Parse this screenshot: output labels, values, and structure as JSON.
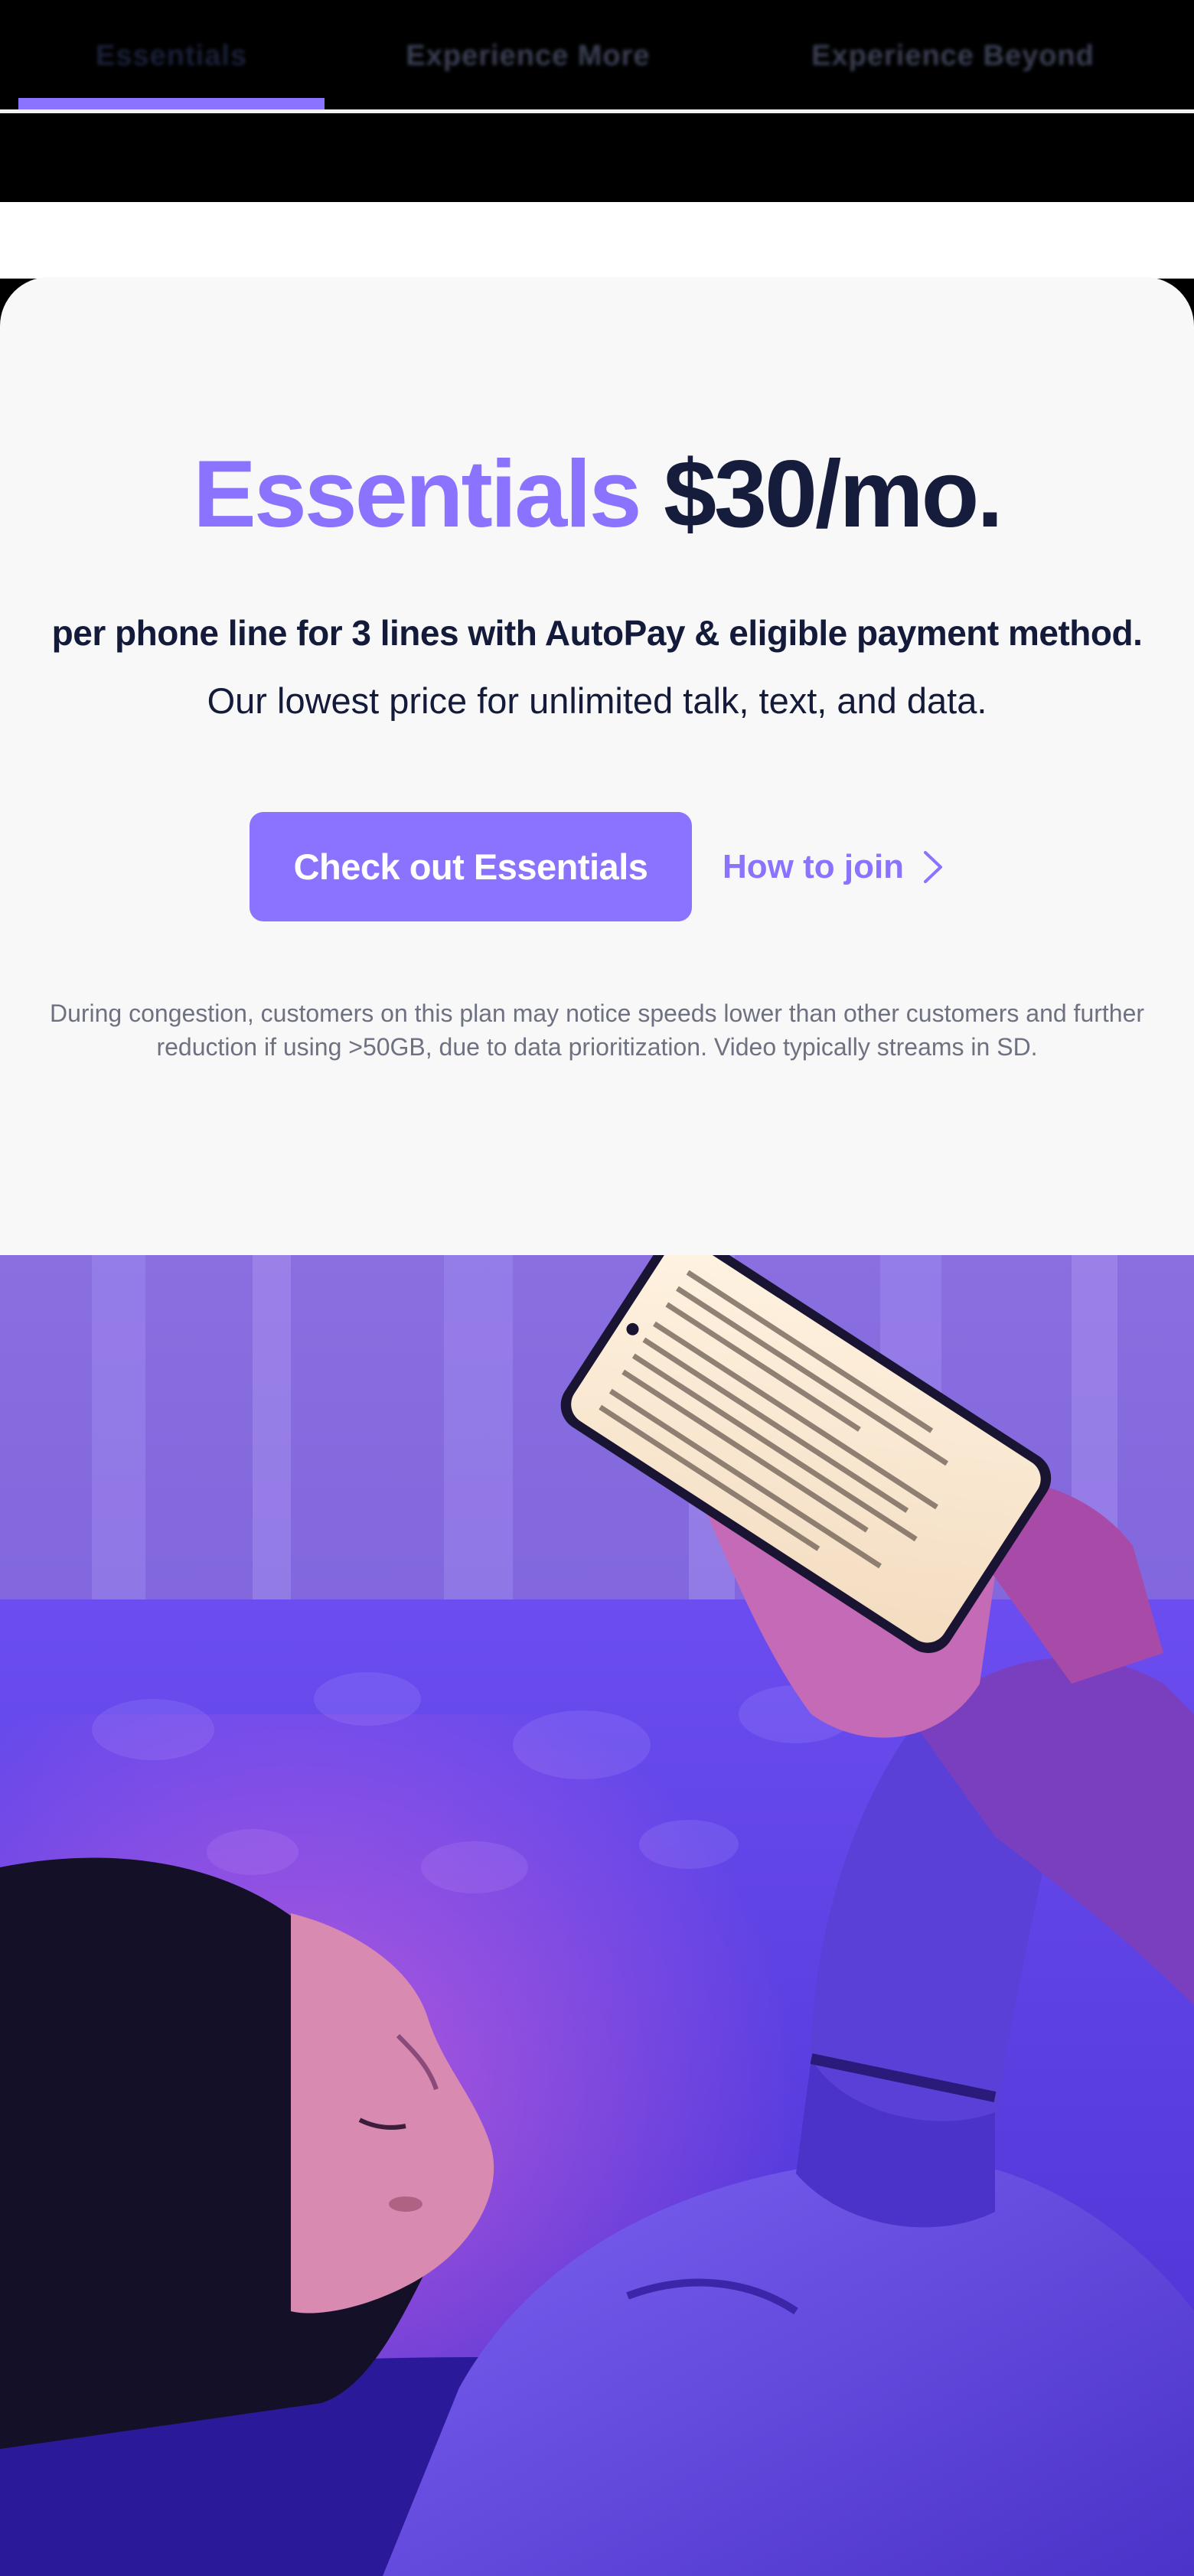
{
  "tabs": [
    {
      "label": "Essentials",
      "active": true
    },
    {
      "label": "Experience More",
      "active": false
    },
    {
      "label": "Experience Beyond",
      "active": false
    }
  ],
  "hero": {
    "plan_name": "Essentials",
    "price": "$30/mo.",
    "price_detail": "per phone line for 3 lines with AutoPay & eligible payment method.",
    "tagline": "Our lowest price for unlimited talk, text, and data.",
    "cta_label": "Check out Essentials",
    "link_label": "How to join",
    "disclaimer": "During congestion, customers on this plan may notice speeds lower than other customers and further reduction if using >50GB, due to data prioritization. Video typically streams in SD."
  },
  "colors": {
    "accent": "#8b73ff",
    "navy": "#161c3c",
    "hero_bg": "#f8f8f9",
    "muted_text": "#6e7180"
  },
  "icons": {
    "join_link": "chevron-right-icon"
  }
}
